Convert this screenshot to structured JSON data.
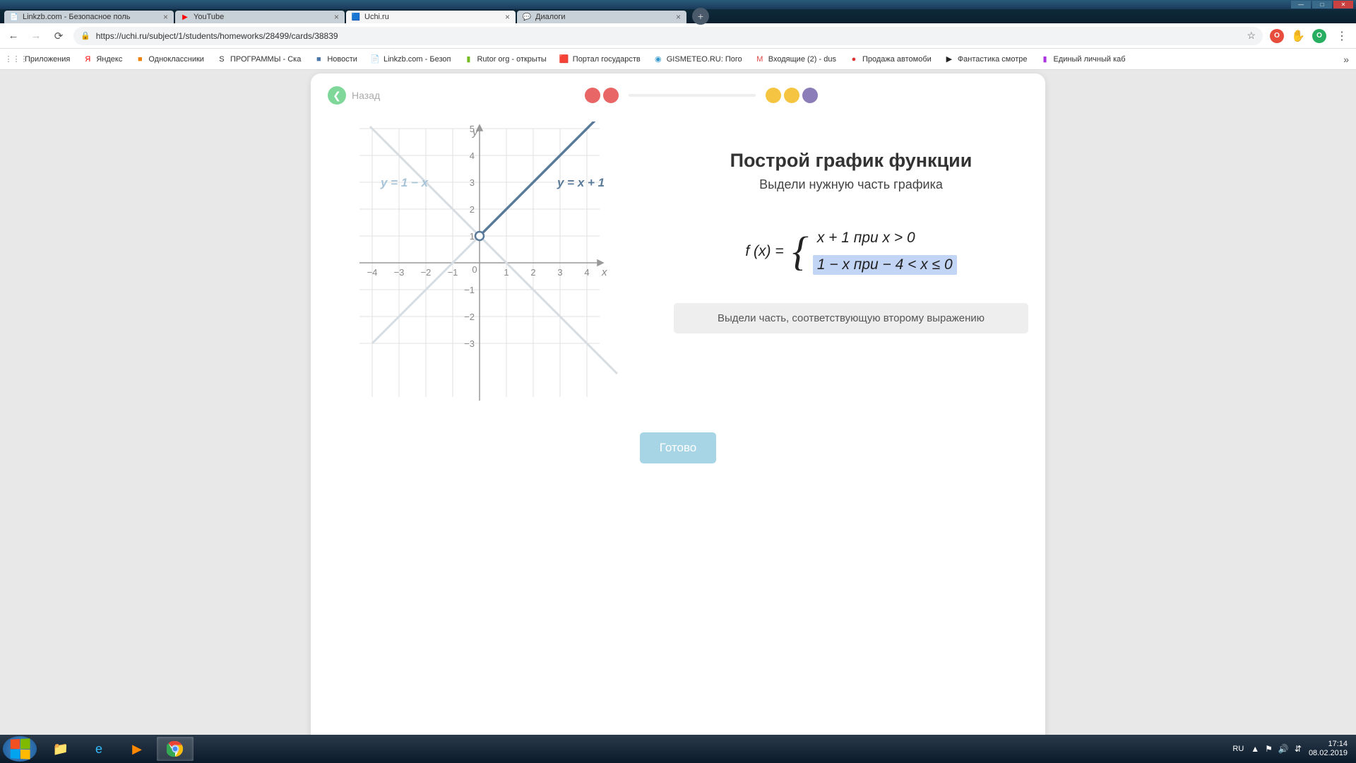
{
  "window": {
    "min": "—",
    "max": "□",
    "close": "✕"
  },
  "tabs": [
    {
      "title": "Linkzb.com - Безопасное поль",
      "favicon": "📄"
    },
    {
      "title": "YouTube",
      "favicon": "▶"
    },
    {
      "title": "Uchi.ru",
      "favicon": "🟦",
      "active": true
    },
    {
      "title": "Диалоги",
      "favicon": "💬"
    }
  ],
  "newTab": "+",
  "nav": {
    "back": "←",
    "forward": "→",
    "reload": "⟳"
  },
  "address": {
    "lock": "🔒",
    "url": "https://uchi.ru/subject/1/students/homeworks/28499/cards/38839",
    "star": "☆"
  },
  "ext": {
    "red": "O",
    "human": "✋",
    "green": "O"
  },
  "menu": "⋮",
  "bookmarksLabel": "Приложения",
  "bookmarks": [
    {
      "label": "Яндекс",
      "icon": "Я",
      "color": "#ff0000"
    },
    {
      "label": "Одноклассники",
      "icon": "■",
      "color": "#ee8208"
    },
    {
      "label": "ПРОГРАММЫ - Ска",
      "icon": "S",
      "color": "#333"
    },
    {
      "label": "Новости",
      "icon": "■",
      "color": "#4a76a8"
    },
    {
      "label": "Linkzb.com - Безоп",
      "icon": "📄",
      "color": "#888"
    },
    {
      "label": "Rutor org - открыты",
      "icon": "▮",
      "color": "#7b2"
    },
    {
      "label": "Портал государств",
      "icon": "🟥",
      "color": "#d52"
    },
    {
      "label": "GISMETEO.RU: Пого",
      "icon": "◉",
      "color": "#39c"
    },
    {
      "label": "Входящие (2) - dus",
      "icon": "M",
      "color": "#d44"
    },
    {
      "label": "Продажа автомоби",
      "icon": "●",
      "color": "#d33"
    },
    {
      "label": "Фантастика смотре",
      "icon": "▶",
      "color": "#222"
    },
    {
      "label": "Единый личный каб",
      "icon": "▮",
      "color": "#a3d"
    }
  ],
  "bmMore": "»",
  "back": {
    "arrow": "❮",
    "label": "Назад"
  },
  "lesson": {
    "title": "Построй график функции",
    "subtitle": "Выдели нужную часть графика",
    "fx": "f (x) =",
    "piece1": "x + 1 при x > 0",
    "piece2": "1 − x при  − 4 < x ≤ 0",
    "hint": "Выдели часть, соответствующую второму выражению",
    "done": "Готово"
  },
  "graph": {
    "yLabel": "y",
    "xLabel": "x",
    "xTicks": [
      "−4",
      "−3",
      "−2",
      "−1",
      "0",
      "1",
      "2",
      "3",
      "4"
    ],
    "yTicks": [
      "5",
      "4",
      "3",
      "2",
      "1",
      "−1",
      "−2",
      "−3"
    ],
    "line1Label": "y = 1 − x",
    "line2Label": "y = x + 1"
  },
  "chart_data": {
    "type": "line",
    "title": "Построй график функции",
    "xlabel": "x",
    "ylabel": "y",
    "xlim": [
      -4.5,
      4.5
    ],
    "ylim": [
      -3.5,
      5.5
    ],
    "series": [
      {
        "name": "y = 1 − x",
        "color": "#cfd8dc",
        "x": [
          -4.5,
          5
        ],
        "y": [
          5.5,
          -4
        ]
      },
      {
        "name": "y = x + 1",
        "color": "#5a7a9a",
        "emphasized_segment": {
          "x": [
            0,
            5
          ],
          "y": [
            1,
            6
          ]
        },
        "x": [
          -4.5,
          5
        ],
        "y": [
          -3.5,
          6
        ]
      }
    ],
    "open_point": {
      "x": 0,
      "y": 1
    }
  },
  "tray": {
    "lang": "RU",
    "up": "▲",
    "flag": "⚑",
    "sound": "🔊",
    "net": "⇵",
    "time": "17:14",
    "date": "08.02.2019"
  }
}
